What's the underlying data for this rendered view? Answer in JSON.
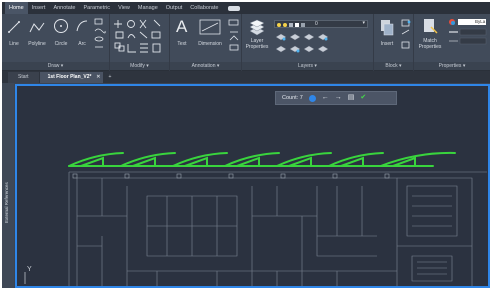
{
  "menu_tabs": [
    "Home",
    "Insert",
    "Annotate",
    "Parametric",
    "View",
    "Manage",
    "Output",
    "Collaborate"
  ],
  "ribbon": {
    "draw": {
      "title": "Draw",
      "tools": [
        "Line",
        "Polyline",
        "Circle",
        "Arc"
      ]
    },
    "modify": {
      "title": "Modify"
    },
    "annotation": {
      "title": "Annotation",
      "text": "Text",
      "dimension": "Dimension"
    },
    "layers": {
      "title": "Layers",
      "layer_properties": "Layer\nProperties",
      "layer_value": "0"
    },
    "block": {
      "title": "Block",
      "insert": "Insert"
    },
    "properties": {
      "title": "Properties",
      "match": "Match\nProperties",
      "bylayer": "ByLa"
    }
  },
  "doc_tabs": {
    "start": "Start",
    "active": "1st Floor Plan_V2*",
    "plus": "+"
  },
  "side_palette": {
    "label": "External References"
  },
  "countbar": {
    "label": "Count: 7",
    "count_icon": "i"
  },
  "ucs_y": "Y",
  "colors": {
    "accent": "#2f86e8",
    "highlight": "#39d43d",
    "background": "#2b3240"
  }
}
